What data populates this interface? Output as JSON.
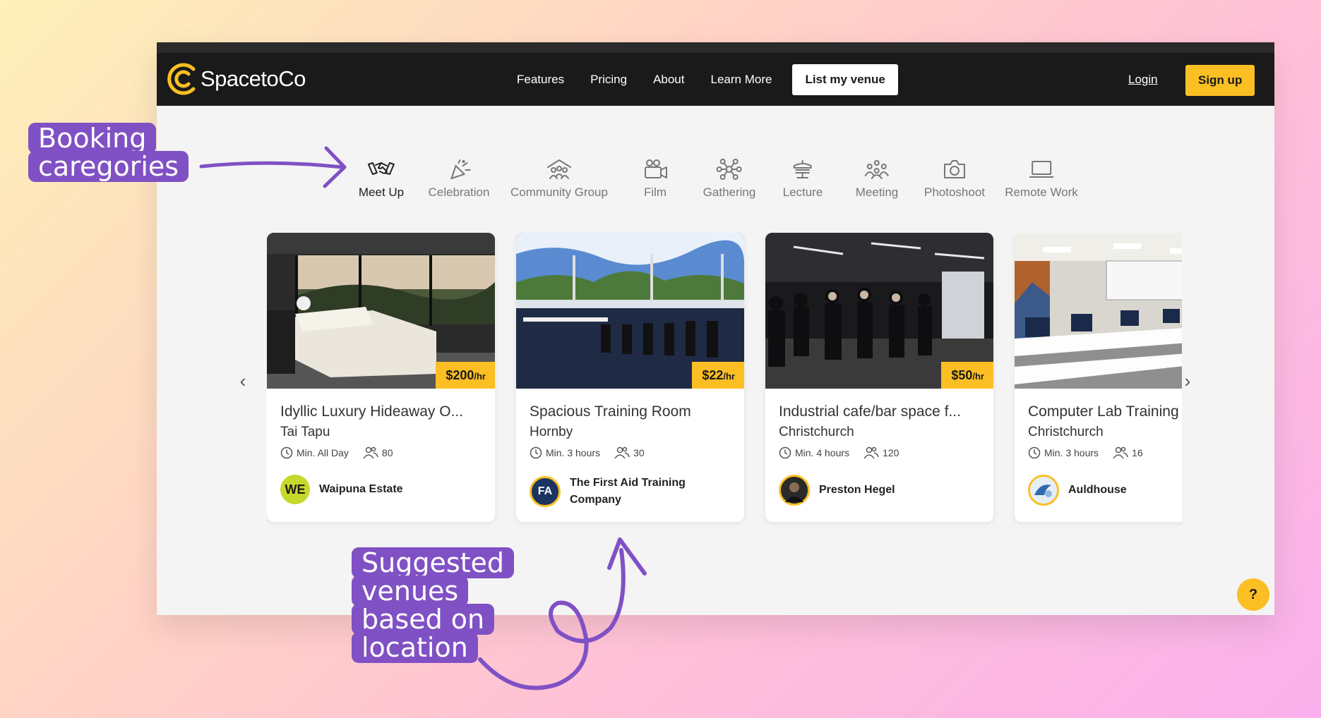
{
  "navbar": {
    "logo_text": "SpacetoCo",
    "links": [
      "Features",
      "Pricing",
      "About",
      "Learn More"
    ],
    "list_venue": "List my venue",
    "login": "Login",
    "signup": "Sign up"
  },
  "categories": [
    {
      "label": "Meet Up",
      "icon": "handshake-icon",
      "active": true
    },
    {
      "label": "Celebration",
      "icon": "party-popper-icon"
    },
    {
      "label": "Community Group",
      "icon": "community-group-icon"
    },
    {
      "label": "Film",
      "icon": "film-camera-icon"
    },
    {
      "label": "Gathering",
      "icon": "network-nodes-icon"
    },
    {
      "label": "Lecture",
      "icon": "lectern-icon"
    },
    {
      "label": "Meeting",
      "icon": "people-group-icon"
    },
    {
      "label": "Photoshoot",
      "icon": "camera-icon"
    },
    {
      "label": "Remote Work",
      "icon": "laptop-icon"
    }
  ],
  "venues": [
    {
      "title": "Idyllic Luxury Hideaway O...",
      "location": "Tai Tapu",
      "min": "Min. All Day",
      "capacity": "80",
      "price": "$200",
      "unit": "/hr",
      "host": "Waipuna Estate",
      "host_initials": "WE"
    },
    {
      "title": "Spacious Training Room",
      "location": "Hornby",
      "min": "Min. 3 hours",
      "capacity": "30",
      "price": "$22",
      "unit": "/hr",
      "host": "The First Aid Training Company",
      "host_initials": "FA"
    },
    {
      "title": "Industrial cafe/bar space f...",
      "location": "Christchurch",
      "min": "Min. 4 hours",
      "capacity": "120",
      "price": "$50",
      "unit": "/hr",
      "host": "Preston Hegel",
      "host_initials": ""
    },
    {
      "title": "Computer Lab Training Room",
      "location": "Christchurch",
      "min": "Min. 3 hours",
      "capacity": "16",
      "price": "",
      "unit": "",
      "host": "Auldhouse",
      "host_initials": ""
    }
  ],
  "carousel": {
    "prev": "‹",
    "next": "›"
  },
  "help_button": "?",
  "annotations": {
    "categories_lines": [
      "Booking",
      "caregories"
    ],
    "venues_lines": [
      "Suggested",
      "venues",
      "based on",
      "location"
    ]
  },
  "colors": {
    "accent": "#fbbf24",
    "navbar": "#1a1a1a",
    "annotation": "#8051c4"
  }
}
